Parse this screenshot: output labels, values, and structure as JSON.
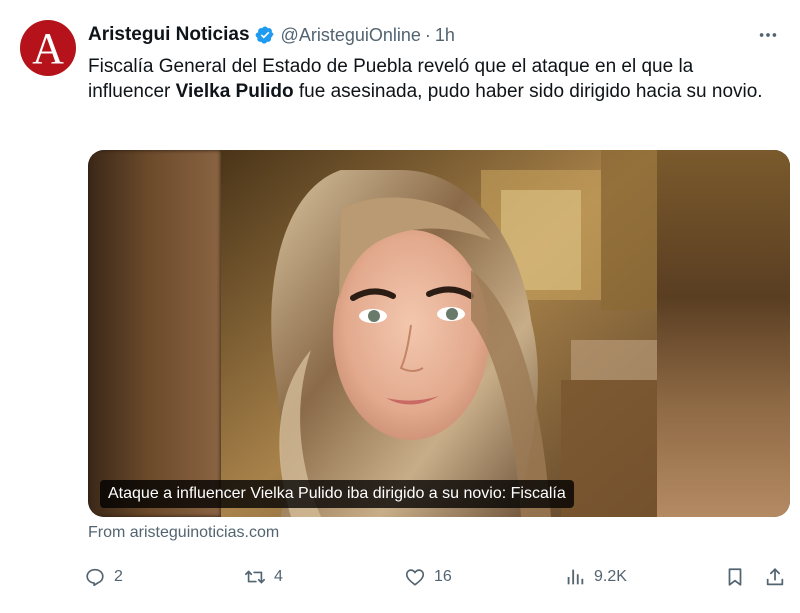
{
  "account": {
    "avatar_letter": "A",
    "display_name": "Aristegui Noticias",
    "handle": "@AristeguiOnline",
    "separator": "·",
    "time": "1h"
  },
  "tweet": {
    "text_part1": "Fiscalía General del Estado de Puebla reveló que el ataque en el que la influencer ",
    "text_bold": "Vielka Pulido",
    "text_part2": " fue asesinada, pudo haber sido dirigido hacia su novio."
  },
  "card": {
    "caption": "Ataque a influencer Vielka Pulido iba dirigido a su novio: Fiscalía",
    "source": "From aristeguinoticias.com"
  },
  "actions": {
    "replies": "2",
    "reposts": "4",
    "likes": "16",
    "views": "9.2K"
  },
  "icons": {
    "more": "more-icon",
    "verified": "verified-badge-icon",
    "reply": "reply-icon",
    "repost": "repost-icon",
    "like": "like-icon",
    "views": "views-icon",
    "bookmark": "bookmark-icon",
    "share": "share-icon"
  },
  "colors": {
    "brand": "#b5121b",
    "verified": "#1d9bf0",
    "muted": "#536471",
    "text": "#0f1419"
  }
}
